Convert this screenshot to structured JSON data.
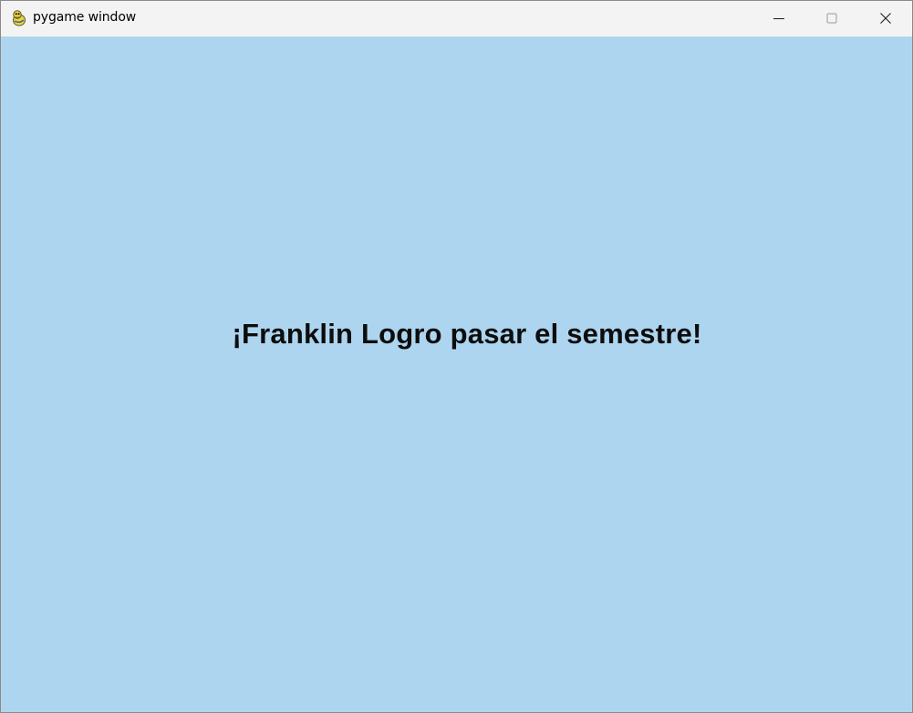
{
  "window": {
    "title": "pygame window",
    "controls": {
      "minimize_icon": "minimize-icon",
      "maximize_icon": "maximize-icon",
      "close_icon": "close-icon"
    }
  },
  "game": {
    "message": "¡Franklin Logro pasar el semestre!",
    "background_color": "#aed5ef",
    "text_color": "#0d0d0d"
  }
}
